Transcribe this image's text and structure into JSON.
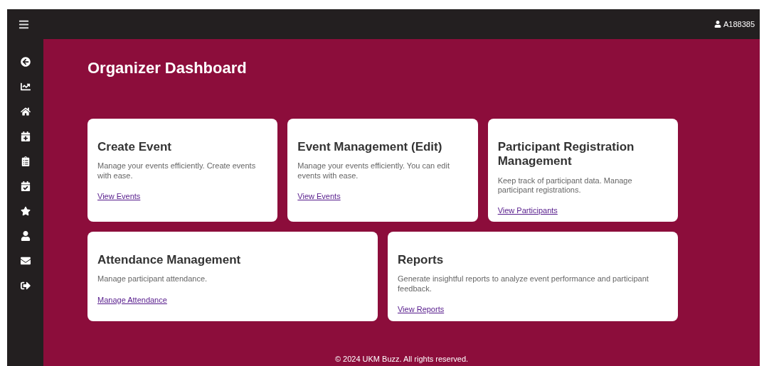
{
  "top_bar": {
    "user": "A188385"
  },
  "page_title": "Organizer Dashboard",
  "cards": [
    {
      "title": "Create Event",
      "description": "Manage your events efficiently. Create events with ease.",
      "link": "View Events"
    },
    {
      "title": "Event Management (Edit)",
      "description": "Manage your events efficiently. You can edit events with ease.",
      "link": "View Events"
    },
    {
      "title": "Participant Registration Management",
      "description": "Keep track of participant data. Manage participant registrations.",
      "link": "View Participants"
    },
    {
      "title": "Attendance Management",
      "description": "Manage participant attendance.",
      "link": "Manage Attendance"
    },
    {
      "title": "Reports",
      "description": "Generate insightful reports to analyze event performance and participant feedback.",
      "link": "View Reports"
    }
  ],
  "footer": "© 2024 UKM Buzz. All rights reserved."
}
